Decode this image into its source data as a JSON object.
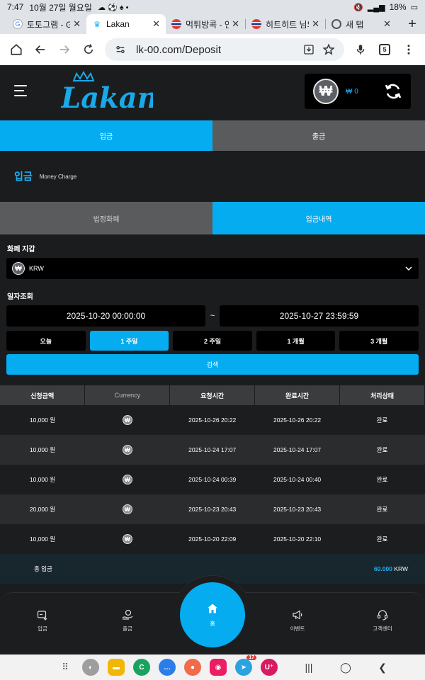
{
  "status_bar": {
    "time": "7:47",
    "date": "10월 27일 월요일",
    "battery": "18%"
  },
  "browser": {
    "tabs": [
      {
        "title": "토토그램 - Go",
        "active": false
      },
      {
        "title": "Lakan",
        "active": true
      },
      {
        "title": "먹튀방콕 - 안",
        "active": false
      },
      {
        "title": "히트히트 님의",
        "active": false
      },
      {
        "title": "새 탭",
        "active": false
      }
    ],
    "url": "lk-00.com/Deposit",
    "tab_count": "5"
  },
  "header": {
    "logo_text": "Lakan",
    "balance": "₩ 0",
    "currency_symbol": "₩"
  },
  "main_tabs": [
    {
      "label": "입금",
      "active": true
    },
    {
      "label": "출금",
      "active": false
    }
  ],
  "page_title": {
    "ko": "입금",
    "en": "Money Charge"
  },
  "sub_tabs": [
    {
      "label": "법정화폐",
      "active": false
    },
    {
      "label": "입금내역",
      "active": true
    }
  ],
  "wallet_label": "화폐 지갑",
  "wallet_select": "KRW",
  "date_label": "일자조회",
  "date_from": "2025-10-20 00:00:00",
  "date_sep": "~",
  "date_to": "2025-10-27 23:59:59",
  "quick_ranges": [
    {
      "label": "오늘",
      "active": false
    },
    {
      "label": "1 주일",
      "active": true
    },
    {
      "label": "2 주일",
      "active": false
    },
    {
      "label": "1 개월",
      "active": false
    },
    {
      "label": "3 개월",
      "active": false
    }
  ],
  "search_label": "검색",
  "table": {
    "headers": [
      "신청금액",
      "Currency",
      "요청시간",
      "완료시간",
      "처리상태"
    ],
    "rows": [
      {
        "amount": "10,000 원",
        "requested": "2025-10-26 20:22",
        "completed": "2025-10-26 20:22",
        "status": "완료"
      },
      {
        "amount": "10,000 원",
        "requested": "2025-10-24 17:07",
        "completed": "2025-10-24 17:07",
        "status": "완료"
      },
      {
        "amount": "10,000 원",
        "requested": "2025-10-24 00:39",
        "completed": "2025-10-24 00:40",
        "status": "완료"
      },
      {
        "amount": "20,000 원",
        "requested": "2025-10-23 20:43",
        "completed": "2025-10-23 20:43",
        "status": "완료"
      },
      {
        "amount": "10,000 원",
        "requested": "2025-10-20 22:09",
        "completed": "2025-10-20 22:10",
        "status": "완료"
      }
    ],
    "total_label": "총 입금",
    "total_value": "60.000",
    "total_unit": "KRW"
  },
  "bottom_nav": {
    "deposit": "입금",
    "withdraw": "출금",
    "home": "홈",
    "event": "이벤트",
    "support": "고객센터"
  },
  "android_badge": "17",
  "colors": {
    "accent": "#05acf0",
    "status_ok": "#3ed13e"
  }
}
